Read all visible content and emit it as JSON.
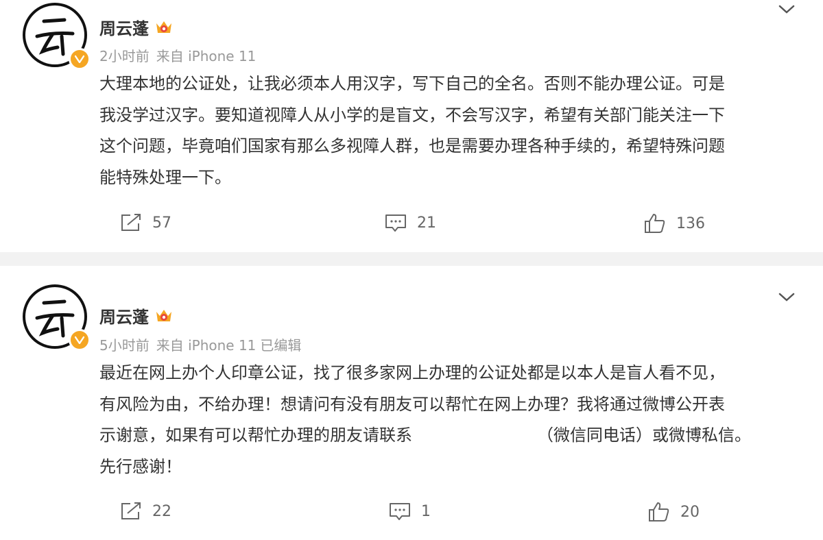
{
  "posts": [
    {
      "author": "周云蓬",
      "time": "2小时前",
      "source": "来自 iPhone 11",
      "edited": "",
      "lines": [
        "大理本地的公证处，让我必须本人用汉字，写下自己的全名。否则不能办理公证。可是",
        "我没学过汉字。要知道视障人从小学的是盲文，不会写汉字，希望有关部门能关注一下",
        "这个问题，毕竟咱们国家有那么多视障人群，也是需要办理各种手续的，希望特殊问题",
        "能特殊处理一下。"
      ],
      "reposts": "57",
      "comments": "21",
      "likes": "136"
    },
    {
      "author": "周云蓬",
      "time": "5小时前",
      "source": "来自 iPhone 11",
      "edited": "已编辑",
      "lines": [
        "最近在网上办个人印章公证，找了很多家网上办理的公证处都是以本人是盲人看不见，",
        "有风险为由，不给办理！想请问有没有朋友可以帮忙在网上办理？我将通过微博公开表"
      ],
      "line3_before": "示谢意，如果有可以帮忙办理的朋友请联系",
      "line3_after": "（微信同电话）或微博私信。",
      "line4": "先行感谢！",
      "reposts": "22",
      "comments": "1",
      "likes": "20"
    }
  ],
  "colors": {
    "meta_text": "#999999",
    "badge": "#f5a623",
    "divider": "#f2f2f2"
  },
  "icons": [
    "avatar-calligraphy",
    "crown-icon",
    "verified-badge-icon",
    "chevron-down-icon",
    "repost-icon",
    "comment-icon",
    "like-icon"
  ]
}
